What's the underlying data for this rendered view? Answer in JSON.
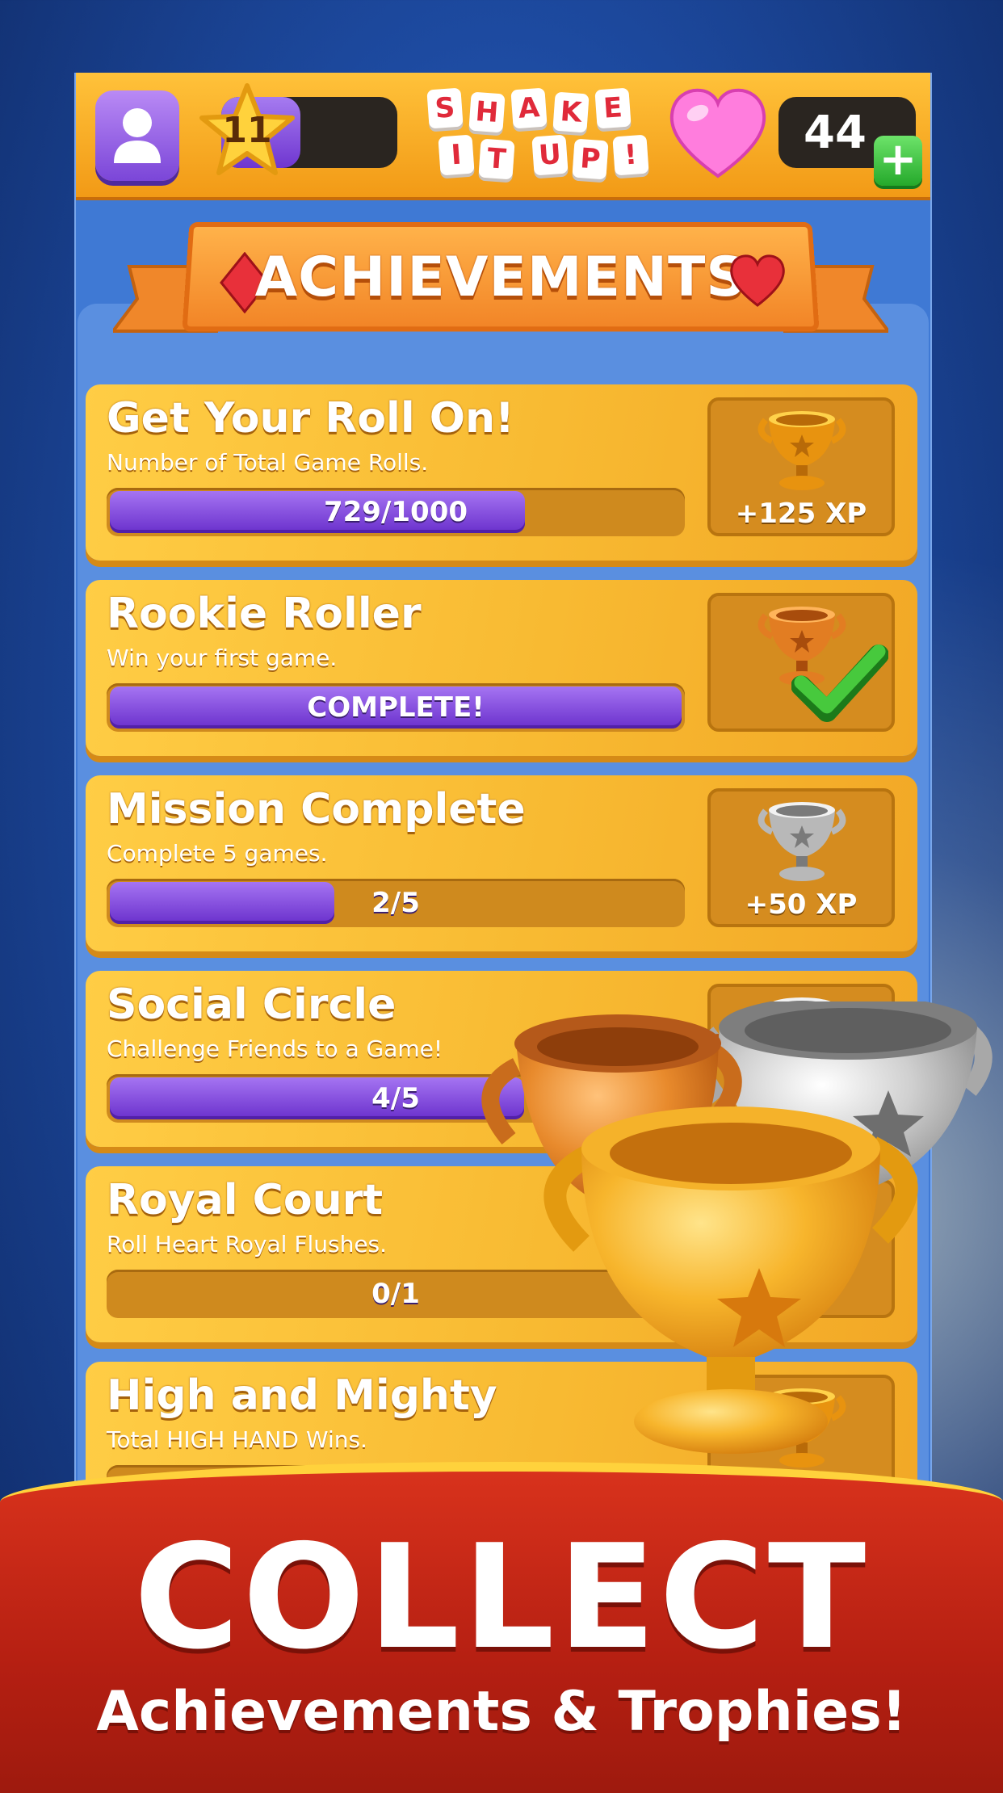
{
  "header": {
    "level": "11",
    "level_progress": 0.45,
    "logo_line1": [
      "S",
      "H",
      "A",
      "K",
      "E"
    ],
    "logo_line2": [
      "I",
      "T",
      "U",
      "P",
      "!"
    ],
    "hearts": "44",
    "plus": "+"
  },
  "ribbon": {
    "title": "ACHIEVEMENTS"
  },
  "achievements": [
    {
      "title": "Get Your Roll On!",
      "desc": "Number of Total Game Rolls.",
      "progress_text": "729/1000",
      "progress": 0.729,
      "reward": "+125 XP",
      "trophy": "gold",
      "complete": false
    },
    {
      "title": "Rookie Roller",
      "desc": "Win your first game.",
      "progress_text": "COMPLETE!",
      "progress": 1.0,
      "reward": "",
      "trophy": "bronze",
      "complete": true
    },
    {
      "title": "Mission Complete",
      "desc": "Complete 5 games.",
      "progress_text": "2/5",
      "progress": 0.4,
      "reward": "+50 XP",
      "trophy": "silver",
      "complete": false
    },
    {
      "title": "Social Circle",
      "desc": "Challenge Friends to a Game!",
      "progress_text": "4/5",
      "progress": 0.728,
      "reward": "",
      "trophy": "silver",
      "complete": false
    },
    {
      "title": "Royal Court",
      "desc": "Roll Heart Royal Flushes.",
      "progress_text": "0/1",
      "progress": 0.0,
      "reward": "",
      "trophy": "gold",
      "complete": false
    },
    {
      "title": "High and Mighty",
      "desc": "Total HIGH HAND Wins.",
      "progress_text": "",
      "progress": 0.0,
      "reward": "",
      "trophy": "gold",
      "complete": false
    }
  ],
  "promo": {
    "headline": "COLLECT",
    "subline": "Achievements & Trophies!"
  },
  "colors": {
    "accent_orange": "#f29a16",
    "progress_purple": "#6a30cc",
    "heart_pink": "#ff6fd8",
    "banner_red": "#c42716",
    "check_green": "#2fb02a"
  }
}
